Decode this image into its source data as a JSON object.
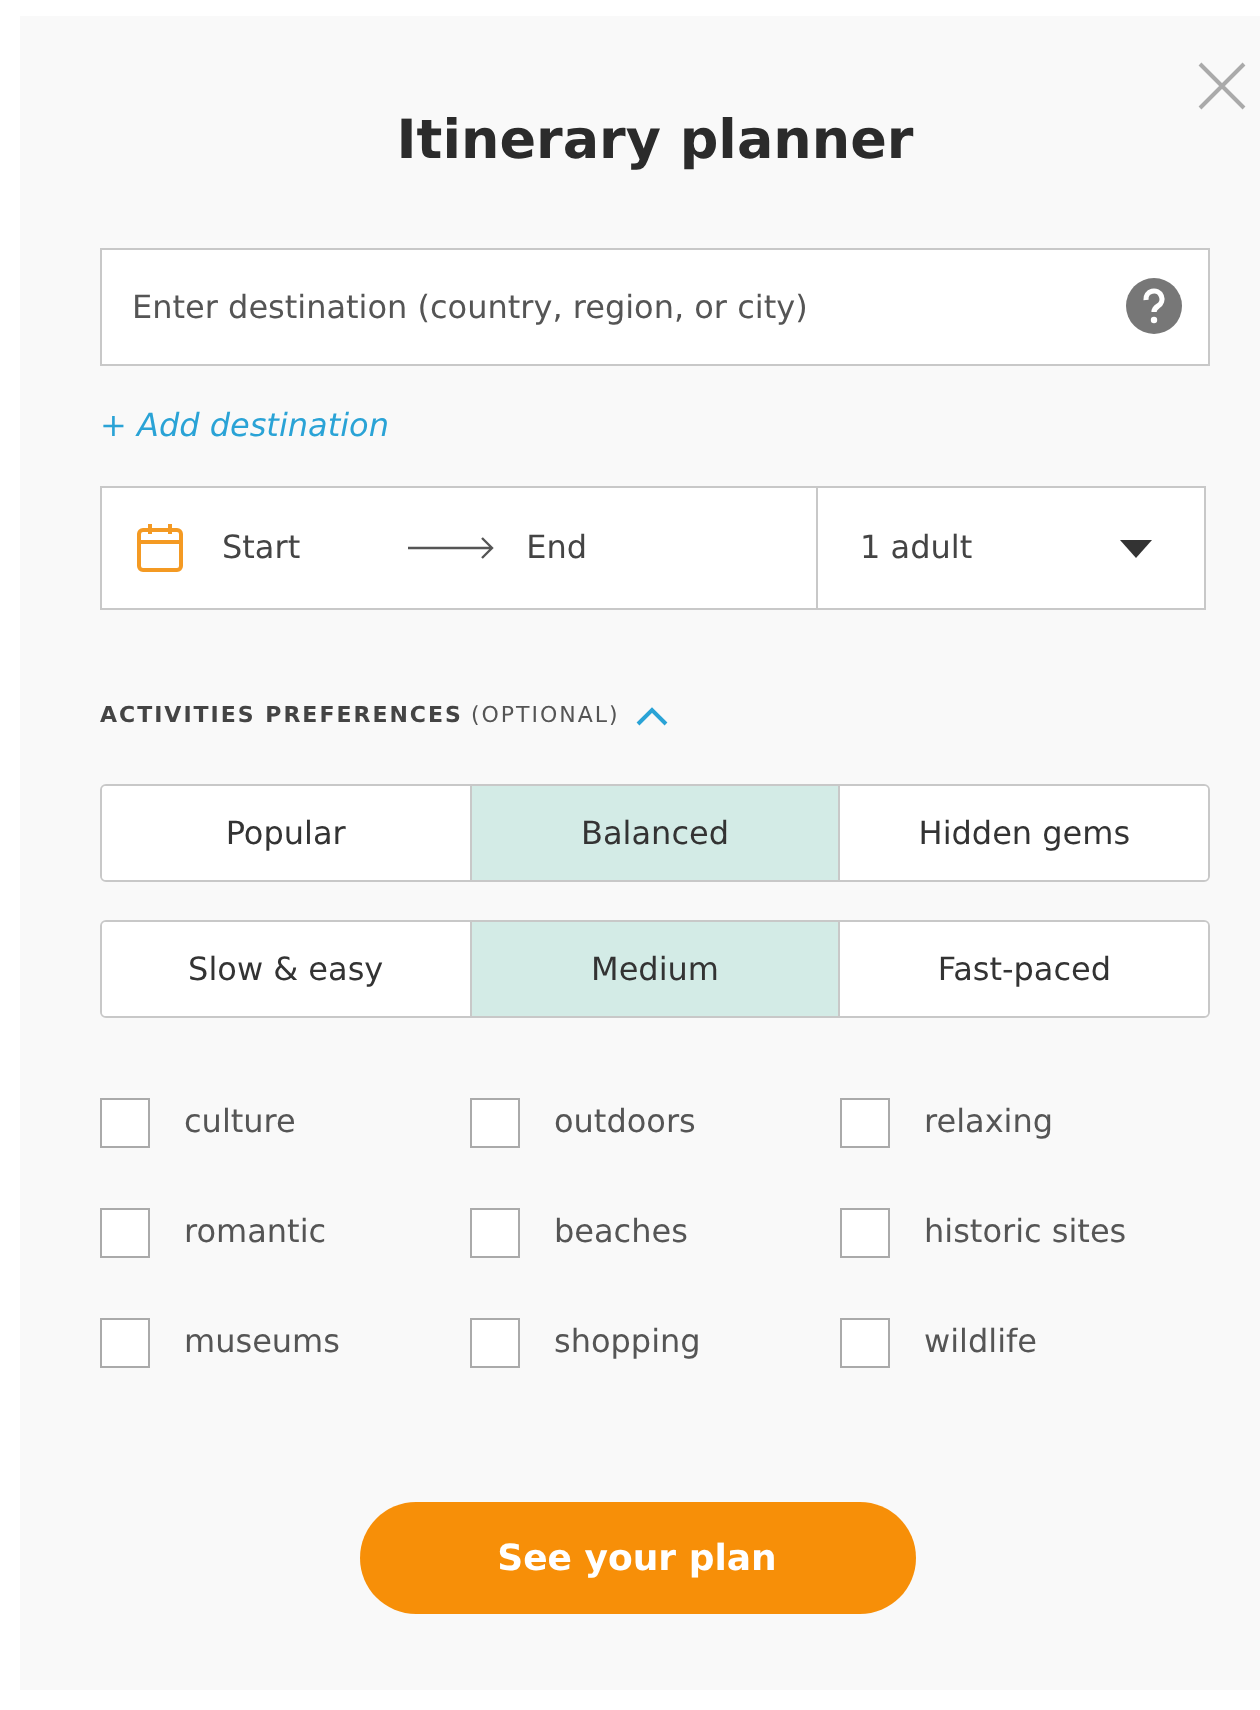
{
  "title": "Itinerary planner",
  "destination": {
    "placeholder": "Enter destination (country, region, or city)"
  },
  "add_destination": "+ Add destination",
  "dates": {
    "start": "Start",
    "end": "End"
  },
  "travelers": {
    "value": "1 adult"
  },
  "activities": {
    "heading": "ACTIVITIES PREFERENCES",
    "optional": "(OPTIONAL)",
    "expanded": true,
    "popularity": [
      {
        "label": "Popular",
        "selected": false
      },
      {
        "label": "Balanced",
        "selected": true
      },
      {
        "label": "Hidden gems",
        "selected": false
      }
    ],
    "pace": [
      {
        "label": "Slow & easy",
        "selected": false
      },
      {
        "label": "Medium",
        "selected": true
      },
      {
        "label": "Fast-paced",
        "selected": false
      }
    ],
    "interests": [
      {
        "label": "culture",
        "checked": false
      },
      {
        "label": "outdoors",
        "checked": false
      },
      {
        "label": "relaxing",
        "checked": false
      },
      {
        "label": "romantic",
        "checked": false
      },
      {
        "label": "beaches",
        "checked": false
      },
      {
        "label": "historic sites",
        "checked": false
      },
      {
        "label": "museums",
        "checked": false
      },
      {
        "label": "shopping",
        "checked": false
      },
      {
        "label": "wildlife",
        "checked": false
      }
    ]
  },
  "submit": "See your plan"
}
